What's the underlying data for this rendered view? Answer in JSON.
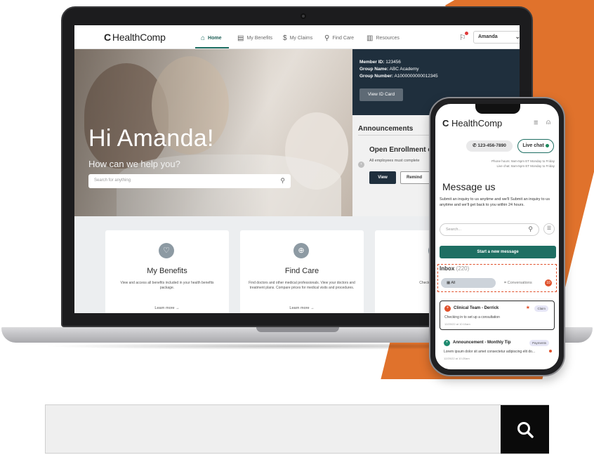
{
  "site": {
    "logo_text": "HealthComp",
    "logo_mark": "C"
  },
  "nav": {
    "items": [
      {
        "label": "Home",
        "icon": "home-icon"
      },
      {
        "label": "My Benefits",
        "icon": "benefits-icon"
      },
      {
        "label": "My Claims",
        "icon": "claims-icon"
      },
      {
        "label": "Find Care",
        "icon": "search-icon"
      },
      {
        "label": "Resources",
        "icon": "library-icon"
      }
    ],
    "user_select": "Amanda"
  },
  "hero": {
    "greeting": "Hi Amanda!",
    "subtitle": "How can we help you?",
    "search_placeholder": "Search for anything"
  },
  "member": {
    "id_label": "Member ID:",
    "id_value": "123456",
    "group_name_label": "Group Name:",
    "group_name_value": "ABC Academy",
    "group_number_label": "Group Number:",
    "group_number_value": "A1000000000012345",
    "id_card_button": "View ID Card"
  },
  "announcements": {
    "title": "Announcements",
    "headline": "Open Enrollment e",
    "body": "All employees must complete",
    "view_button": "View",
    "remind_button": "Remind"
  },
  "cards": [
    {
      "title": "My Benefits",
      "body": "View and access all benefits included in your health benefits package.",
      "link": "Learn more →"
    },
    {
      "title": "Find Care",
      "body": "Find doctors and other medical professionals. View your doctors and treatment plans. Compare prices for medical visits and procedures.",
      "link": "Learn more →"
    },
    {
      "title": "My",
      "body": "Check your deductible",
      "link": "Le"
    }
  ],
  "phone": {
    "logo_text": "HealthComp",
    "phone_number": "123-456-7890",
    "live_chat": "Live chat",
    "hours_line1": "Phone hours: 9am-5pm ET Monday to Friday",
    "hours_line2": "Live chat: 8am-5pm ET Monday to Friday",
    "title": "Message us",
    "description": "Submit an inquiry to us anytime and we'll Submit an inquiry to us anytime and we'll get back to you within 24 hours.",
    "search_placeholder": "Search...",
    "new_message_button": "Start a new message",
    "inbox_label": "Inbox",
    "inbox_count": "(220)",
    "filter_all": "All",
    "filter_conversations": "Conversations",
    "conversations_badge": "10",
    "messages": [
      {
        "title": "Clinical Team - Derrick",
        "tag": "Claim",
        "body": "Checking in to set up a consultation",
        "time": "12/20/22 at 10:10am"
      },
      {
        "title": "Announcement - Monthly Tip",
        "tag": "Payments",
        "body": "Lorem ipsum dolor sit amet consectetur adipiscing elit do...",
        "time": "12/20/22 at 10:20am"
      }
    ]
  },
  "colors": {
    "brand_green": "#1e6f63",
    "navy": "#1f2f3d",
    "accent_orange": "#e0722c",
    "alert_red": "#e0502a"
  }
}
